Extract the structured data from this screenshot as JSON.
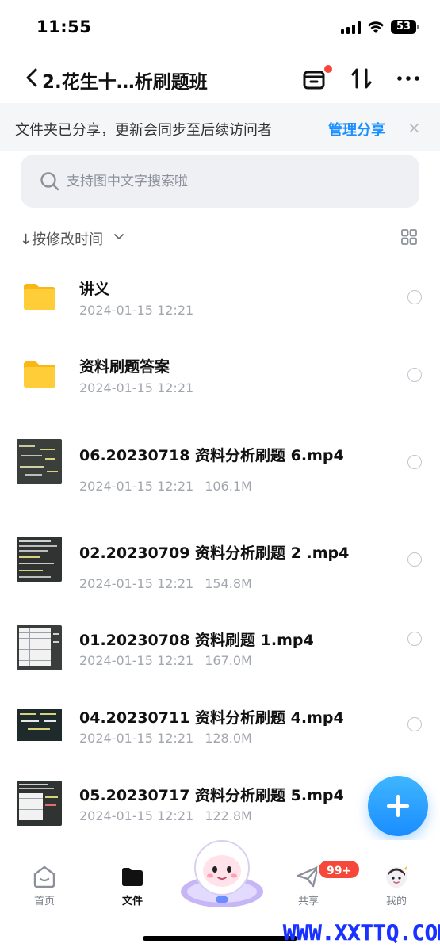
{
  "status_bar": {
    "time": "11:55",
    "battery": "53"
  },
  "nav": {
    "title": "2.花生十…析刷题班"
  },
  "banner": {
    "text": "文件夹已分享，更新会同步至后续访问者",
    "action": "管理分享",
    "close": "×"
  },
  "search": {
    "placeholder": "支持图中文字搜索啦"
  },
  "sort": {
    "label": "↓按修改时间"
  },
  "files": [
    {
      "type": "folder",
      "name": "讲义",
      "date": "2024-01-15 12:21",
      "size": ""
    },
    {
      "type": "folder",
      "name": "资料刷题答案",
      "date": "2024-01-15 12:21",
      "size": ""
    },
    {
      "type": "video",
      "name": "06.20230718 资料分析刷题 6.mp4",
      "date": "2024-01-15 12:21",
      "size": "106.1M"
    },
    {
      "type": "video",
      "name": "02.20230709 资料分析刷题 2 .mp4",
      "date": "2024-01-15 12:21",
      "size": "154.8M"
    },
    {
      "type": "video",
      "name": "01.20230708 资料刷题 1.mp4",
      "date": "2024-01-15 12:21",
      "size": "167.0M"
    },
    {
      "type": "video",
      "name": "04.20230711 资料分析刷题 4.mp4",
      "date": "2024-01-15 12:21",
      "size": "128.0M"
    },
    {
      "type": "video",
      "name": "05.20230717 资料分析刷题 5.mp4",
      "date": "2024-01-15 12:21",
      "size": "122.8M"
    }
  ],
  "tabbar": {
    "home": "首页",
    "files": "文件",
    "share": "共享",
    "share_badge": "99+",
    "me": "我的"
  },
  "watermark": "WWW.XXTTQ.COM",
  "colors": {
    "accent": "#1a8fff",
    "badge": "#f5483a",
    "folder": "#ffc929"
  }
}
